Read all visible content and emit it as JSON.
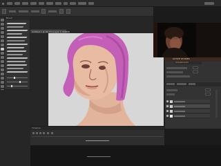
{
  "window": {
    "app": "Photoshop",
    "document_tab_label": "Untitled-1 @ 66.7% (Layer 1, RGB/8)"
  },
  "panels": {
    "brushes_header": "Brush",
    "timeline_header": "Timeline",
    "navigator_header": "ACTIVE STUDIES",
    "navigator_sub": "Adjustments"
  },
  "colors": {
    "foreground": "#1a1a1a",
    "background": "#ffffff",
    "canvas_bg": "#d8d7d7",
    "hair": "#c45fb8",
    "skin": "#e6b7a0",
    "accent_orange": "#cfa27a"
  },
  "icons": {
    "menu_dots": "window-dots-icon",
    "eye": "eye-icon",
    "layer_thumb": "layer-thumbnail-icon"
  }
}
